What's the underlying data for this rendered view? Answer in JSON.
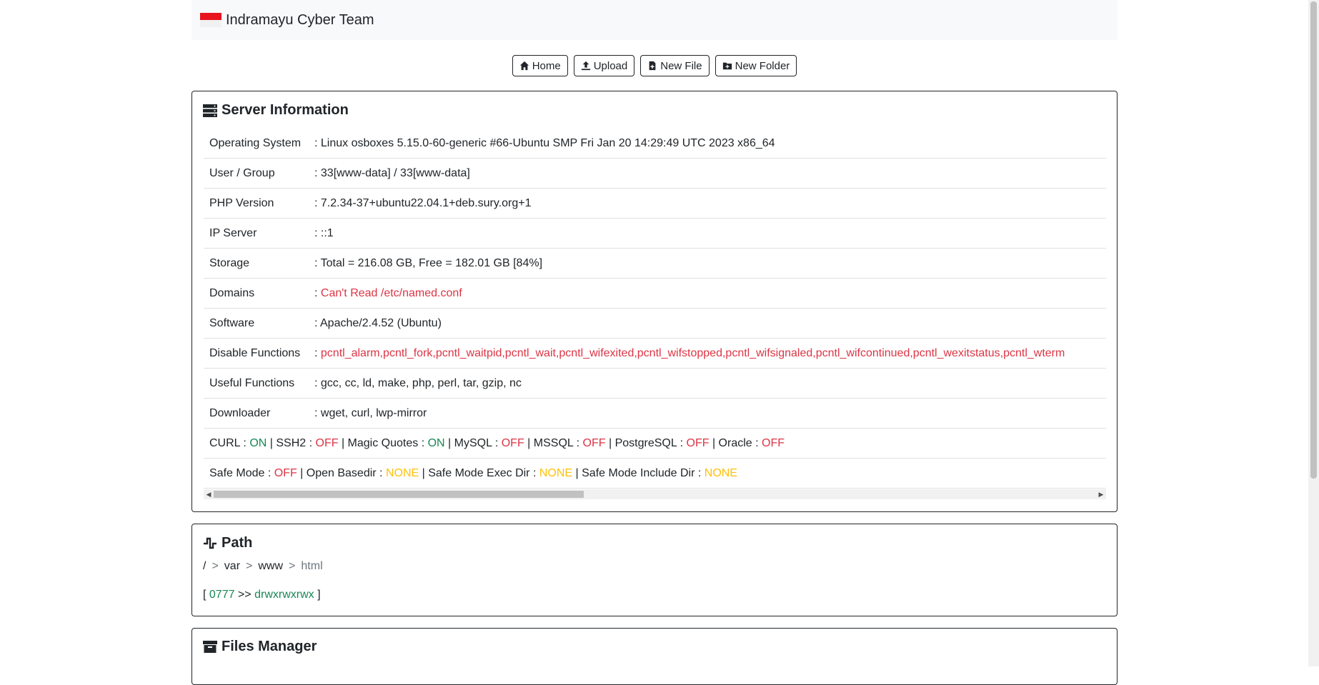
{
  "navbar": {
    "brand": "Indramayu Cyber Team"
  },
  "toolbar": {
    "home_label": "Home",
    "upload_label": "Upload",
    "new_file_label": "New File",
    "new_folder_label": "New Folder"
  },
  "server_info": {
    "title": "Server Information",
    "rows": [
      {
        "key": "Operating System",
        "value": ": Linux osboxes 5.15.0-60-generic #66-Ubuntu SMP Fri Jan 20 14:29:49 UTC 2023 x86_64"
      },
      {
        "key": "User / Group",
        "value": ": 33[www-data] / 33[www-data]"
      },
      {
        "key": "PHP Version",
        "value": ": 7.2.34-37+ubuntu22.04.1+deb.sury.org+1"
      },
      {
        "key": "IP Server",
        "value": ": ::1"
      },
      {
        "key": "Storage",
        "value": ": Total = 216.08 GB, Free = 182.01 GB [84%]"
      },
      {
        "key": "Domains",
        "prefix": ": ",
        "value": "Can't Read /etc/named.conf"
      },
      {
        "key": "Software",
        "value": ": Apache/2.4.52 (Ubuntu)"
      },
      {
        "key": "Disable Functions",
        "prefix": ": ",
        "value": "pcntl_alarm,pcntl_fork,pcntl_waitpid,pcntl_wait,pcntl_wifexited,pcntl_wifstopped,pcntl_wifsignaled,pcntl_wifcontinued,pcntl_wexitstatus,pcntl_wterm"
      },
      {
        "key": "Useful Functions",
        "value": ": gcc, cc, ld, make, php, perl, tar, gzip, nc"
      },
      {
        "key": "Downloader",
        "value": ": wget, curl, lwp-mirror"
      }
    ],
    "status_line1": [
      {
        "label": "CURL : ",
        "value": "ON"
      },
      {
        "label": " | SSH2 : ",
        "value": "OFF"
      },
      {
        "label": " | Magic Quotes : ",
        "value": "ON"
      },
      {
        "label": " | MySQL : ",
        "value": "OFF"
      },
      {
        "label": " | MSSQL : ",
        "value": "OFF"
      },
      {
        "label": " | PostgreSQL : ",
        "value": "OFF"
      },
      {
        "label": " | Oracle : ",
        "value": "OFF"
      }
    ],
    "status_line2": [
      {
        "label": "Safe Mode : ",
        "value": "OFF"
      },
      {
        "label": " | Open Basedir : ",
        "value": "NONE"
      },
      {
        "label": " | Safe Mode Exec Dir : ",
        "value": "NONE"
      },
      {
        "label": " | Safe Mode Include Dir : ",
        "value": "NONE"
      }
    ]
  },
  "path": {
    "title": "Path",
    "segments": [
      "/",
      "var",
      "www",
      "html"
    ],
    "separator": ">",
    "perm_open": "[",
    "perm_octal": "0777",
    "perm_arrow": ">>",
    "perm_string": "drwxrwxrwx",
    "perm_close": "]"
  },
  "files": {
    "title": "Files Manager"
  },
  "colors": {
    "red": "#dc3545",
    "green": "#198754",
    "yellow": "#ffc107",
    "flag_red": "#e8141e"
  }
}
